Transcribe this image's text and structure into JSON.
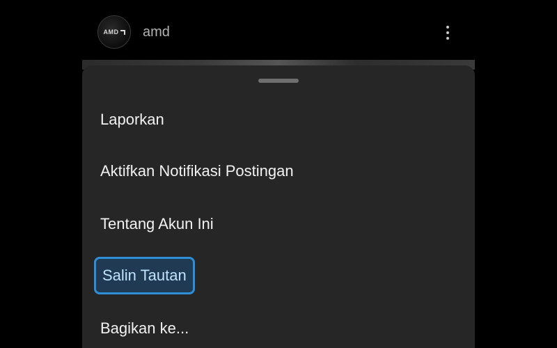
{
  "header": {
    "avatar_logo_text": "AMD",
    "username": "amd",
    "more_icon": "more-vertical-icon"
  },
  "sheet": {
    "items": [
      {
        "label": "Laporkan",
        "highlighted": false
      },
      {
        "label": "Aktifkan Notifikasi Postingan",
        "highlighted": false
      },
      {
        "label": "Tentang Akun Ini",
        "highlighted": false
      },
      {
        "label": "Salin Tautan",
        "highlighted": true
      },
      {
        "label": "Bagikan ke...",
        "highlighted": false
      }
    ]
  },
  "colors": {
    "background": "#000000",
    "sheet": "#262626",
    "highlight_border": "#2f8fd6",
    "highlight_fill": "#1f3a52"
  }
}
